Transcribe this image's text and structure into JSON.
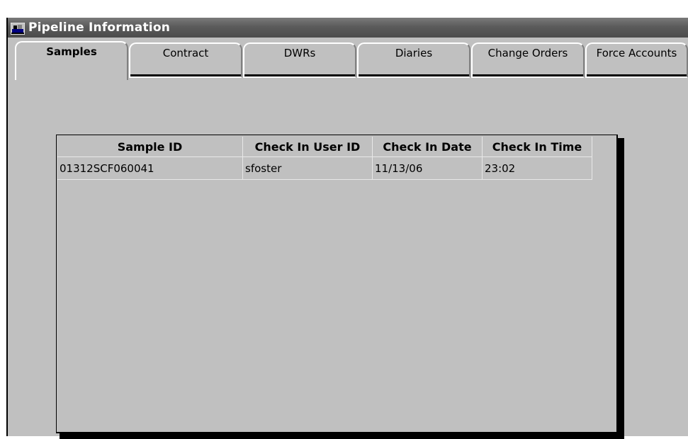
{
  "window": {
    "title": "Pipeline Information",
    "icon": "app-window-icon"
  },
  "tabs": [
    {
      "label": "Samples",
      "active": true
    },
    {
      "label": "Contract",
      "active": false
    },
    {
      "label": "DWRs",
      "active": false
    },
    {
      "label": "Diaries",
      "active": false
    },
    {
      "label": "Change Orders",
      "active": false
    },
    {
      "label": "Force Accounts",
      "active": false
    }
  ],
  "samples_table": {
    "columns": [
      "Sample ID",
      "Check In User ID",
      "Check In Date",
      "Check In Time"
    ],
    "rows": [
      [
        "01312SCF060041",
        "sfoster",
        "11/13/06",
        "23:02"
      ]
    ]
  },
  "colors": {
    "window_bg": "#c0c0c0",
    "titlebar": "#5b5b5b",
    "title_text": "#ffffff"
  }
}
